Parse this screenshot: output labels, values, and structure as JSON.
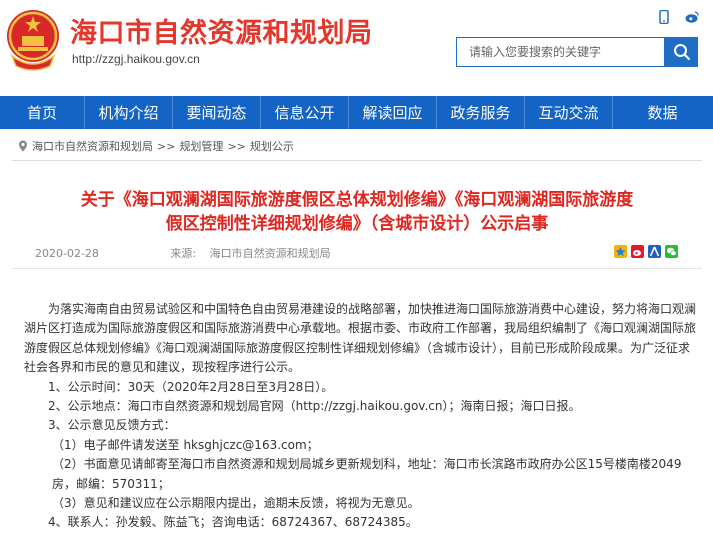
{
  "header": {
    "site_title": "海口市自然资源和规划局",
    "site_url": "http://zzgj.haikou.gov.cn",
    "search_placeholder": "请输入您要搜索的关键字"
  },
  "nav": {
    "items": [
      "首页",
      "机构介绍",
      "要闻动态",
      "信息公开",
      "解读回应",
      "政务服务",
      "互动交流",
      "数据"
    ]
  },
  "breadcrumb": {
    "items": [
      "海口市自然资源和规划局",
      "规划管理",
      "规划公示"
    ],
    "separator": ">>"
  },
  "article": {
    "title_line1": "关于《海口观澜湖国际旅游度假区总体规划修编》《海口观澜湖国际旅游度",
    "title_line2": "假区控制性详细规划修编》（含城市设计）公示启事",
    "date": "2020-02-28",
    "source_label": "来源:",
    "source": "海口市自然资源和规划局",
    "paragraphs": [
      "为落实海南自由贸易试验区和中国特色自由贸易港建设的战略部署，加快推进海口国际旅游消费中心建设，努力将海口观澜湖片区打造成为国际旅游度假区和国际旅游消费中心承载地。根据市委、市政府工作部署，我局组织编制了《海口观澜湖国际旅游度假区总体规划修编》《海口观澜湖国际旅游度假区控制性详细规划修编》（含城市设计），目前已形成阶段成果。为广泛征求社会各界和市民的意见和建议，现按程序进行公示。",
      "1、公示时间：30天（2020年2月28日至3月28日）。",
      "2、公示地点：海口市自然资源和规划局官网（http://zzgj.haikou.gov.cn）；海南日报；海口日报。",
      "3、公示意见反馈方式：",
      "（1）电子邮件请发送至 hksghjczc@163.com；",
      "（2）书面意见请邮寄至海口市自然资源和规划局城乡更新规划科，地址：海口市长滨路市政府办公区15号楼南楼2049房，邮编：570311；",
      "（3）意见和建议应在公示期限内提出，逾期未反馈，将视为无意见。",
      "4、联系人：孙发毅、陈益飞；咨询电话：68724367、68724385。"
    ]
  },
  "colors": {
    "brand_red": "#e4362a",
    "nav_blue": "#1464c6",
    "title_red": "#e0261f"
  },
  "icons": [
    "emblem-icon",
    "mobile-icon",
    "weibo-icon",
    "search-icon",
    "location-icon",
    "share-qzone-icon",
    "share-weibo-icon",
    "share-renren-icon",
    "share-wechat-icon"
  ]
}
